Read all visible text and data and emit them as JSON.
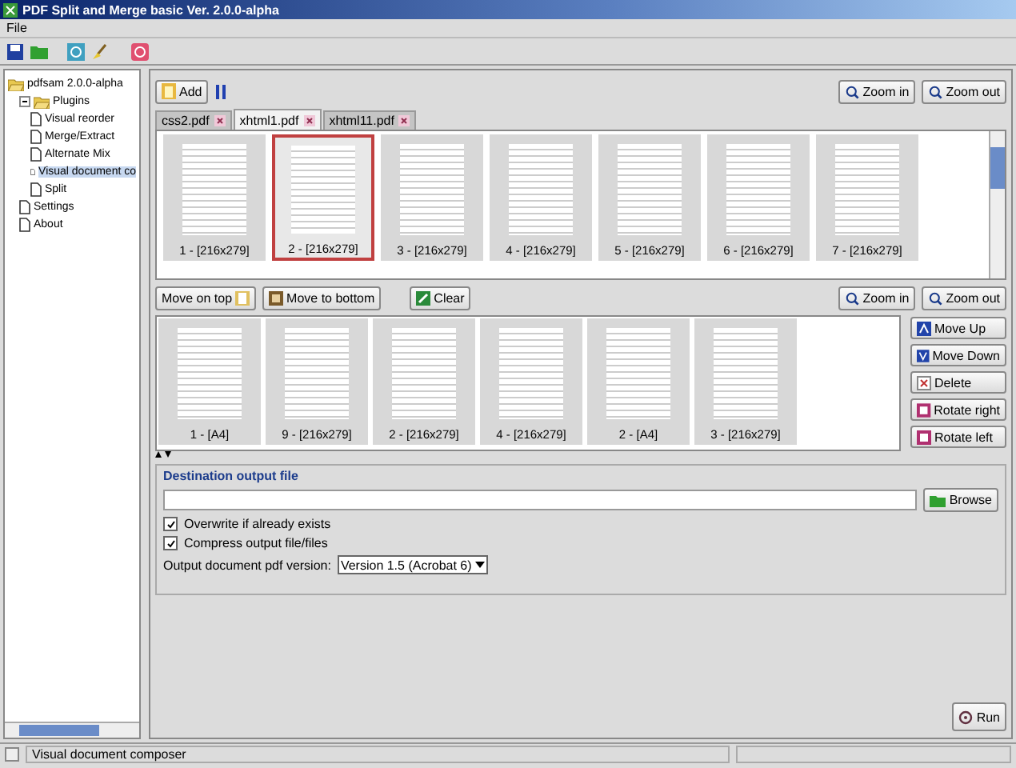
{
  "window": {
    "title": "PDF Split and Merge basic Ver. 2.0.0-alpha"
  },
  "menu": [
    "File"
  ],
  "tree": {
    "label": "pdfsam 2.0.0-alpha",
    "expanded": true,
    "selected": false,
    "children": [
      {
        "label": "Plugins",
        "expanded": true,
        "selected": false,
        "children": [
          {
            "label": "Visual reorder",
            "selected": false
          },
          {
            "label": "Merge/Extract",
            "selected": false
          },
          {
            "label": "Alternate Mix",
            "selected": false
          },
          {
            "label": "Visual document co",
            "selected": true
          },
          {
            "label": "Split",
            "selected": false
          }
        ]
      },
      {
        "label": "Settings",
        "selected": false
      },
      {
        "label": "About",
        "selected": false
      }
    ]
  },
  "source": {
    "add_button": "Add",
    "zoom_in": "Zoom in",
    "zoom_out": "Zoom out",
    "tabs": [
      {
        "label": "css2.pdf",
        "selected": false
      },
      {
        "label": "xhtml1.pdf",
        "selected": true
      },
      {
        "label": "xhtml11.pdf",
        "selected": false
      }
    ],
    "pages": [
      {
        "label": "1 - [216x279]",
        "selected": false
      },
      {
        "label": "2 - [216x279]",
        "selected": true
      },
      {
        "label": "3 - [216x279]",
        "selected": false
      },
      {
        "label": "4 - [216x279]",
        "selected": false
      },
      {
        "label": "5 - [216x279]",
        "selected": false
      },
      {
        "label": "6 - [216x279]",
        "selected": false
      },
      {
        "label": "7 - [216x279]",
        "selected": false
      }
    ]
  },
  "composer": {
    "toolbar": [
      "Move on top",
      "Move to bottom",
      "Clear"
    ],
    "zoom_in": "Zoom in",
    "zoom_out": "Zoom out",
    "pages": [
      {
        "label": "1 - [A4]",
        "selected": false
      },
      {
        "label": "9 - [216x279]",
        "selected": false
      },
      {
        "label": "2 - [216x279]",
        "selected": false
      },
      {
        "label": "4 - [216x279]",
        "selected": false
      },
      {
        "label": "2 - [A4]",
        "selected": false
      },
      {
        "label": "3 - [216x279]",
        "selected": false
      }
    ],
    "side_buttons": [
      "Move Up",
      "Move Down",
      "Delete",
      "Rotate right",
      "Rotate left"
    ]
  },
  "destination": {
    "title": "Destination output file",
    "browse": "Browse",
    "options": [
      {
        "label": "Overwrite if already exists",
        "checked": true
      },
      {
        "label": "Compress output file/files",
        "checked": true
      }
    ],
    "version_label": "Output document pdf version:",
    "version": "Version 1.5 (Acrobat 6)"
  },
  "run_button": "Run",
  "status_bar": "Visual document composer"
}
